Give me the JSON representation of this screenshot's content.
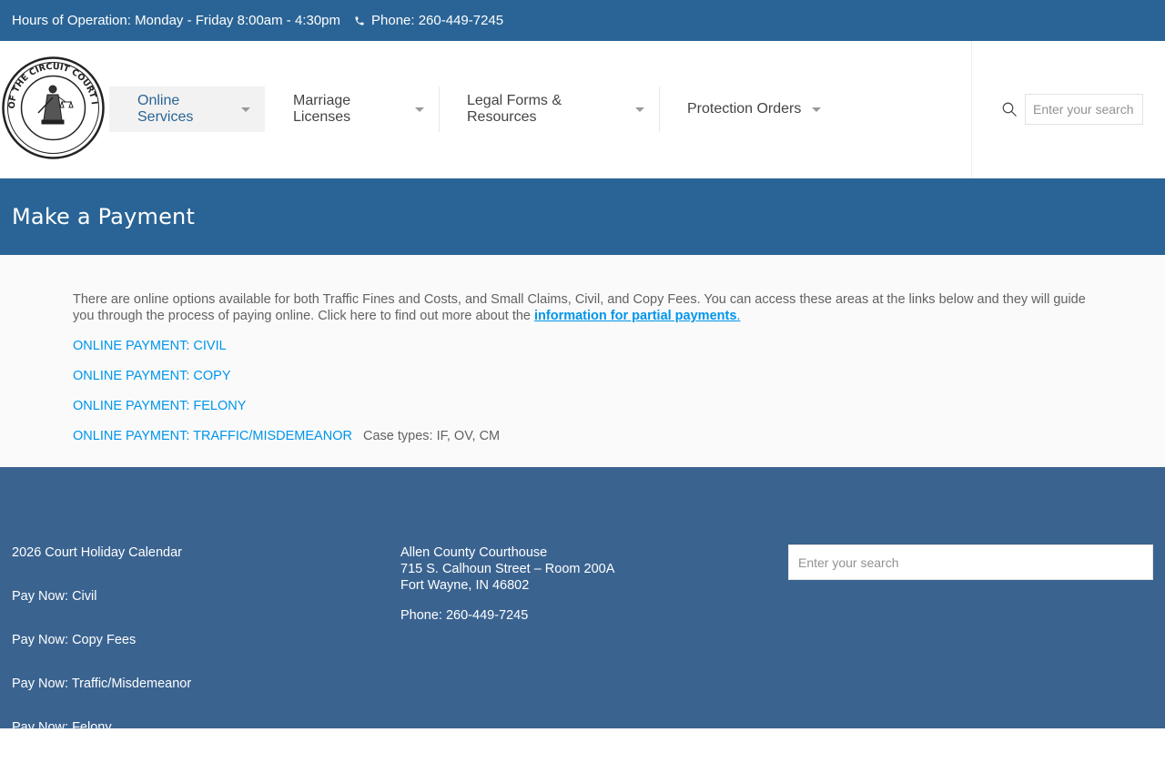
{
  "topbar": {
    "hours": "Hours of Operation: Monday - Friday 8:00am - 4:30pm",
    "phone": "Phone: 260-449-7245"
  },
  "header": {
    "logo_alt": "CLERK OF THE CIRCUIT COURT INDIANA",
    "nav": [
      {
        "label": "Online Services"
      },
      {
        "label": "Marriage Licenses"
      },
      {
        "label": "Legal Forms & Resources"
      },
      {
        "label": "Protection Orders"
      }
    ],
    "search_placeholder": "Enter your search"
  },
  "page": {
    "title": "Make a Payment",
    "intro": "There are online options available for both Traffic Fines and Costs, and Small Claims, Civil, and Copy Fees. You can access these areas at the links below and they will guide you through the process of paying online. Click here to find out more about the",
    "partial_link": "information for partial payments",
    "partial_suffix": ".",
    "links": [
      {
        "label": "ONLINE PAYMENT: CIVIL"
      },
      {
        "label": "ONLINE PAYMENT: COPY"
      },
      {
        "label": "ONLINE PAYMENT: FELONY"
      },
      {
        "label": "ONLINE PAYMENT: TRAFFIC/MISDEMEANOR"
      }
    ],
    "case_types": "Case types:  IF, OV, CM"
  },
  "footer": {
    "links": [
      {
        "label": "2026 Court Holiday Calendar"
      },
      {
        "label": "Pay Now: Civil"
      },
      {
        "label": "Pay Now: Copy Fees"
      },
      {
        "label": "Pay Now: Traffic/Misdemeanor"
      },
      {
        "label": "Pay Now: Felony"
      }
    ],
    "address_line1": "Allen County Courthouse",
    "address_line2": "715 S. Calhoun Street – Room 200A",
    "address_line3": "Fort Wayne, IN 46802",
    "phone": "Phone: 260-449-7245",
    "search_placeholder": "Enter your search"
  },
  "colors": {
    "brand_blue": "#2a6496",
    "footer_blue": "#3a6390",
    "link_blue": "#0095eb"
  }
}
